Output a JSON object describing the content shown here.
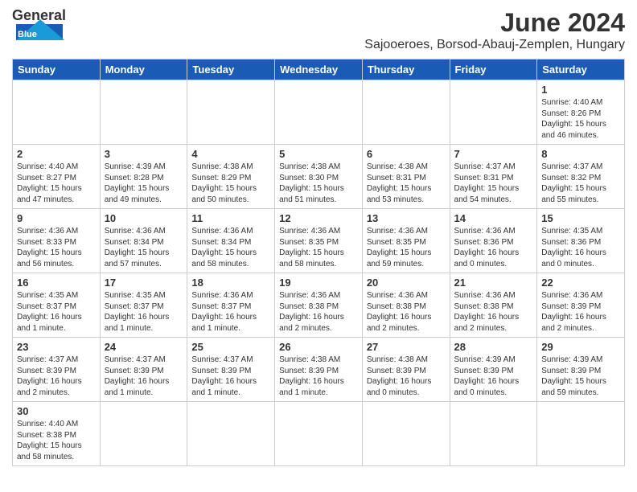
{
  "header": {
    "logo_general": "General",
    "logo_blue": "Blue",
    "month_title": "June 2024",
    "subtitle": "Sajooeroes, Borsod-Abauj-Zemplen, Hungary"
  },
  "weekdays": [
    "Sunday",
    "Monday",
    "Tuesday",
    "Wednesday",
    "Thursday",
    "Friday",
    "Saturday"
  ],
  "weeks": [
    [
      {
        "day": null,
        "info": null
      },
      {
        "day": null,
        "info": null
      },
      {
        "day": null,
        "info": null
      },
      {
        "day": null,
        "info": null
      },
      {
        "day": null,
        "info": null
      },
      {
        "day": null,
        "info": null
      },
      {
        "day": "1",
        "info": "Sunrise: 4:40 AM\nSunset: 8:26 PM\nDaylight: 15 hours\nand 46 minutes."
      }
    ],
    [
      {
        "day": "2",
        "info": "Sunrise: 4:40 AM\nSunset: 8:27 PM\nDaylight: 15 hours\nand 47 minutes."
      },
      {
        "day": "3",
        "info": "Sunrise: 4:39 AM\nSunset: 8:28 PM\nDaylight: 15 hours\nand 49 minutes."
      },
      {
        "day": "4",
        "info": "Sunrise: 4:38 AM\nSunset: 8:29 PM\nDaylight: 15 hours\nand 50 minutes."
      },
      {
        "day": "5",
        "info": "Sunrise: 4:38 AM\nSunset: 8:30 PM\nDaylight: 15 hours\nand 51 minutes."
      },
      {
        "day": "6",
        "info": "Sunrise: 4:38 AM\nSunset: 8:31 PM\nDaylight: 15 hours\nand 53 minutes."
      },
      {
        "day": "7",
        "info": "Sunrise: 4:37 AM\nSunset: 8:31 PM\nDaylight: 15 hours\nand 54 minutes."
      },
      {
        "day": "8",
        "info": "Sunrise: 4:37 AM\nSunset: 8:32 PM\nDaylight: 15 hours\nand 55 minutes."
      }
    ],
    [
      {
        "day": "9",
        "info": "Sunrise: 4:36 AM\nSunset: 8:33 PM\nDaylight: 15 hours\nand 56 minutes."
      },
      {
        "day": "10",
        "info": "Sunrise: 4:36 AM\nSunset: 8:34 PM\nDaylight: 15 hours\nand 57 minutes."
      },
      {
        "day": "11",
        "info": "Sunrise: 4:36 AM\nSunset: 8:34 PM\nDaylight: 15 hours\nand 58 minutes."
      },
      {
        "day": "12",
        "info": "Sunrise: 4:36 AM\nSunset: 8:35 PM\nDaylight: 15 hours\nand 58 minutes."
      },
      {
        "day": "13",
        "info": "Sunrise: 4:36 AM\nSunset: 8:35 PM\nDaylight: 15 hours\nand 59 minutes."
      },
      {
        "day": "14",
        "info": "Sunrise: 4:36 AM\nSunset: 8:36 PM\nDaylight: 16 hours\nand 0 minutes."
      },
      {
        "day": "15",
        "info": "Sunrise: 4:35 AM\nSunset: 8:36 PM\nDaylight: 16 hours\nand 0 minutes."
      }
    ],
    [
      {
        "day": "16",
        "info": "Sunrise: 4:35 AM\nSunset: 8:37 PM\nDaylight: 16 hours\nand 1 minute."
      },
      {
        "day": "17",
        "info": "Sunrise: 4:35 AM\nSunset: 8:37 PM\nDaylight: 16 hours\nand 1 minute."
      },
      {
        "day": "18",
        "info": "Sunrise: 4:36 AM\nSunset: 8:37 PM\nDaylight: 16 hours\nand 1 minute."
      },
      {
        "day": "19",
        "info": "Sunrise: 4:36 AM\nSunset: 8:38 PM\nDaylight: 16 hours\nand 2 minutes."
      },
      {
        "day": "20",
        "info": "Sunrise: 4:36 AM\nSunset: 8:38 PM\nDaylight: 16 hours\nand 2 minutes."
      },
      {
        "day": "21",
        "info": "Sunrise: 4:36 AM\nSunset: 8:38 PM\nDaylight: 16 hours\nand 2 minutes."
      },
      {
        "day": "22",
        "info": "Sunrise: 4:36 AM\nSunset: 8:39 PM\nDaylight: 16 hours\nand 2 minutes."
      }
    ],
    [
      {
        "day": "23",
        "info": "Sunrise: 4:37 AM\nSunset: 8:39 PM\nDaylight: 16 hours\nand 2 minutes."
      },
      {
        "day": "24",
        "info": "Sunrise: 4:37 AM\nSunset: 8:39 PM\nDaylight: 16 hours\nand 1 minute."
      },
      {
        "day": "25",
        "info": "Sunrise: 4:37 AM\nSunset: 8:39 PM\nDaylight: 16 hours\nand 1 minute."
      },
      {
        "day": "26",
        "info": "Sunrise: 4:38 AM\nSunset: 8:39 PM\nDaylight: 16 hours\nand 1 minute."
      },
      {
        "day": "27",
        "info": "Sunrise: 4:38 AM\nSunset: 8:39 PM\nDaylight: 16 hours\nand 0 minutes."
      },
      {
        "day": "28",
        "info": "Sunrise: 4:39 AM\nSunset: 8:39 PM\nDaylight: 16 hours\nand 0 minutes."
      },
      {
        "day": "29",
        "info": "Sunrise: 4:39 AM\nSunset: 8:39 PM\nDaylight: 15 hours\nand 59 minutes."
      }
    ],
    [
      {
        "day": "30",
        "info": "Sunrise: 4:40 AM\nSunset: 8:38 PM\nDaylight: 15 hours\nand 58 minutes."
      },
      {
        "day": null,
        "info": null
      },
      {
        "day": null,
        "info": null
      },
      {
        "day": null,
        "info": null
      },
      {
        "day": null,
        "info": null
      },
      {
        "day": null,
        "info": null
      },
      {
        "day": null,
        "info": null
      }
    ]
  ]
}
